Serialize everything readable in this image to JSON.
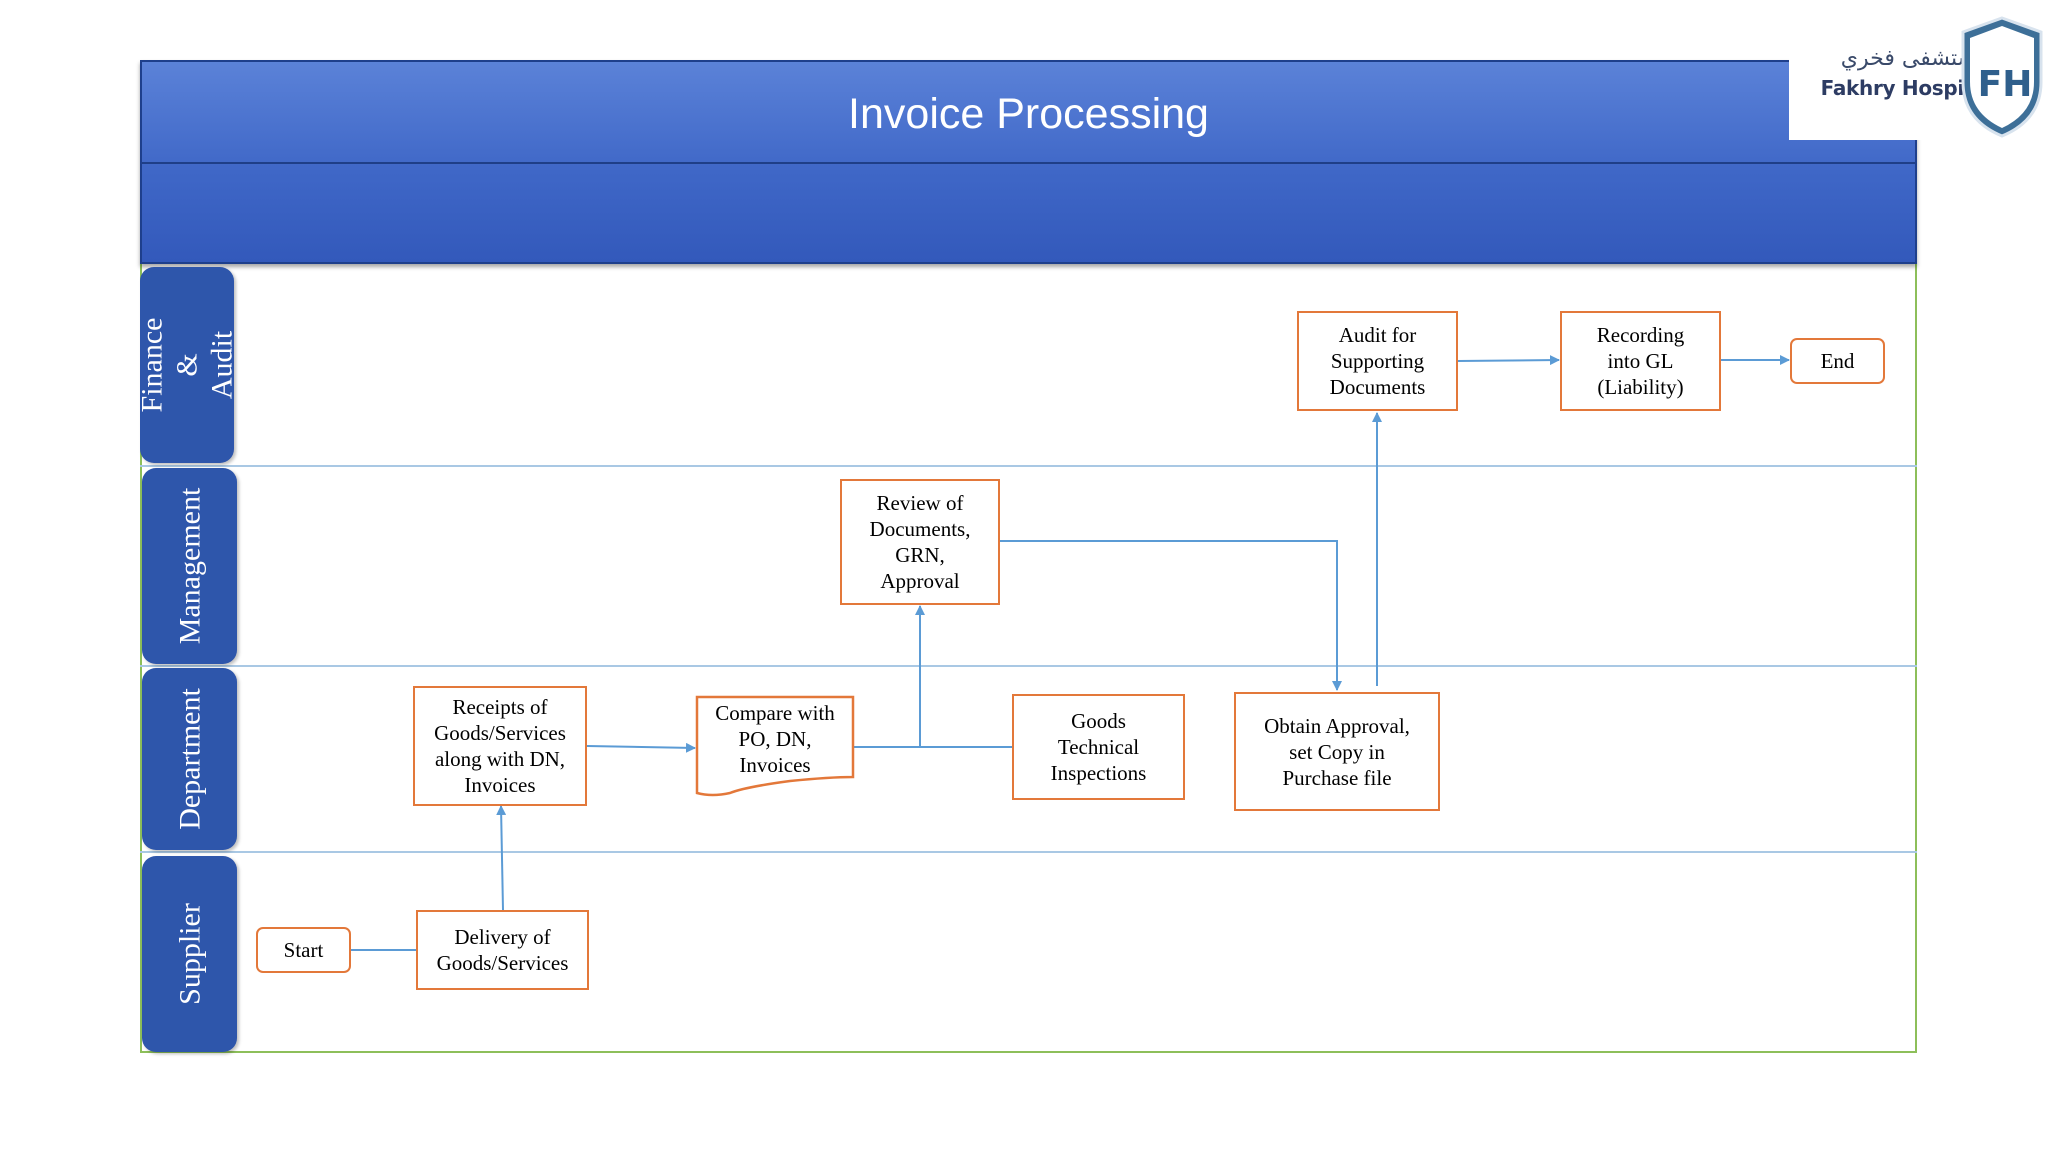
{
  "title": "Invoice Processing",
  "logo": {
    "arabic_name": "مستشفى فخري",
    "english_name": "Fakhry Hospital",
    "letters": "FH",
    "colors": {
      "shield": "#3d6f98",
      "crescent": "#c8203a"
    }
  },
  "lanes": [
    {
      "id": "finance",
      "label": "Finance &\nAudit"
    },
    {
      "id": "management",
      "label": "Management"
    },
    {
      "id": "department",
      "label": "Department"
    },
    {
      "id": "supplier",
      "label": "Supplier"
    }
  ],
  "nodes": {
    "start": "Start",
    "delivery": "Delivery of\nGoods/Services",
    "receipts": "Receipts of\nGoods/Services\nalong with DN,\nInvoices",
    "compare": "Compare with\nPO, DN,\nInvoices",
    "review": "Review of\nDocuments,\nGRN,\nApproval",
    "inspection": "Goods\nTechnical\nInspections",
    "obtain": "Obtain Approval,\nset Copy in\nPurchase file",
    "audit": "Audit for\nSupporting\nDocuments",
    "recording": "Recording\ninto GL\n(Liability)",
    "end": "End"
  },
  "colors": {
    "header": "#3f67c7",
    "lane_label": "#2e56ab",
    "box_border": "#e3783a",
    "connector": "#5b9bd5",
    "frame": "#8dbf5a"
  }
}
